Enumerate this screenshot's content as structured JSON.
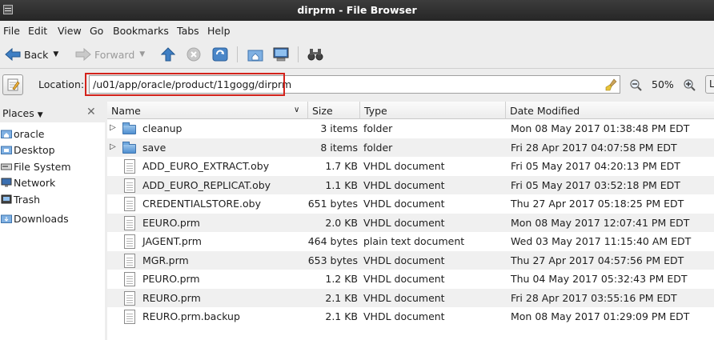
{
  "window": {
    "title": "dirprm - File Browser"
  },
  "menu": [
    "File",
    "Edit",
    "View",
    "Go",
    "Bookmarks",
    "Tabs",
    "Help"
  ],
  "toolbar": {
    "back_label": "Back",
    "forward_label": "Forward"
  },
  "location": {
    "label": "Location:",
    "value": "/u01/app/oracle/product/11gogg/dirprm",
    "zoom": "50%",
    "right_button": "L"
  },
  "sidebar": {
    "header": "Places",
    "items": [
      {
        "label": "oracle",
        "icon": "home-folder-icon"
      },
      {
        "label": "Desktop",
        "icon": "desktop-folder-icon"
      },
      {
        "label": "File System",
        "icon": "drive-icon"
      },
      {
        "label": "Network",
        "icon": "network-icon"
      },
      {
        "label": "Trash",
        "icon": "trash-icon"
      },
      {
        "label": "Downloads",
        "icon": "downloads-folder-icon"
      }
    ]
  },
  "columns": {
    "name": "Name",
    "size": "Size",
    "type": "Type",
    "date": "Date Modified"
  },
  "files": [
    {
      "name": "cleanup",
      "size": "3 items",
      "type": "folder",
      "date": "Mon 08 May 2017 01:38:48 PM EDT",
      "kind": "folder"
    },
    {
      "name": "save",
      "size": "8 items",
      "type": "folder",
      "date": "Fri 28 Apr 2017 04:07:58 PM EDT",
      "kind": "folder"
    },
    {
      "name": "ADD_EURO_EXTRACT.oby",
      "size": "1.7 KB",
      "type": "VHDL document",
      "date": "Fri 05 May 2017 04:20:13 PM EDT",
      "kind": "file"
    },
    {
      "name": "ADD_EURO_REPLICAT.oby",
      "size": "1.1 KB",
      "type": "VHDL document",
      "date": "Fri 05 May 2017 03:52:18 PM EDT",
      "kind": "file"
    },
    {
      "name": "CREDENTIALSTORE.oby",
      "size": "651 bytes",
      "type": "VHDL document",
      "date": "Thu 27 Apr 2017 05:18:25 PM EDT",
      "kind": "file"
    },
    {
      "name": "EEURO.prm",
      "size": "2.0 KB",
      "type": "VHDL document",
      "date": "Mon 08 May 2017 12:07:41 PM EDT",
      "kind": "file"
    },
    {
      "name": "JAGENT.prm",
      "size": "464 bytes",
      "type": "plain text document",
      "date": "Wed 03 May 2017 11:15:40 AM EDT",
      "kind": "file"
    },
    {
      "name": "MGR.prm",
      "size": "653 bytes",
      "type": "VHDL document",
      "date": "Thu 27 Apr 2017 04:57:56 PM EDT",
      "kind": "file"
    },
    {
      "name": "PEURO.prm",
      "size": "1.2 KB",
      "type": "VHDL document",
      "date": "Thu 04 May 2017 05:32:43 PM EDT",
      "kind": "file"
    },
    {
      "name": "REURO.prm",
      "size": "2.1 KB",
      "type": "VHDL document",
      "date": "Fri 28 Apr 2017 03:55:16 PM EDT",
      "kind": "file"
    },
    {
      "name": "REURO.prm.backup",
      "size": "2.1 KB",
      "type": "VHDL document",
      "date": "Mon 08 May 2017 01:29:09 PM EDT",
      "kind": "file"
    }
  ],
  "colors": {
    "highlight_box": "#d3221b",
    "folder": "#4f8fd0"
  }
}
